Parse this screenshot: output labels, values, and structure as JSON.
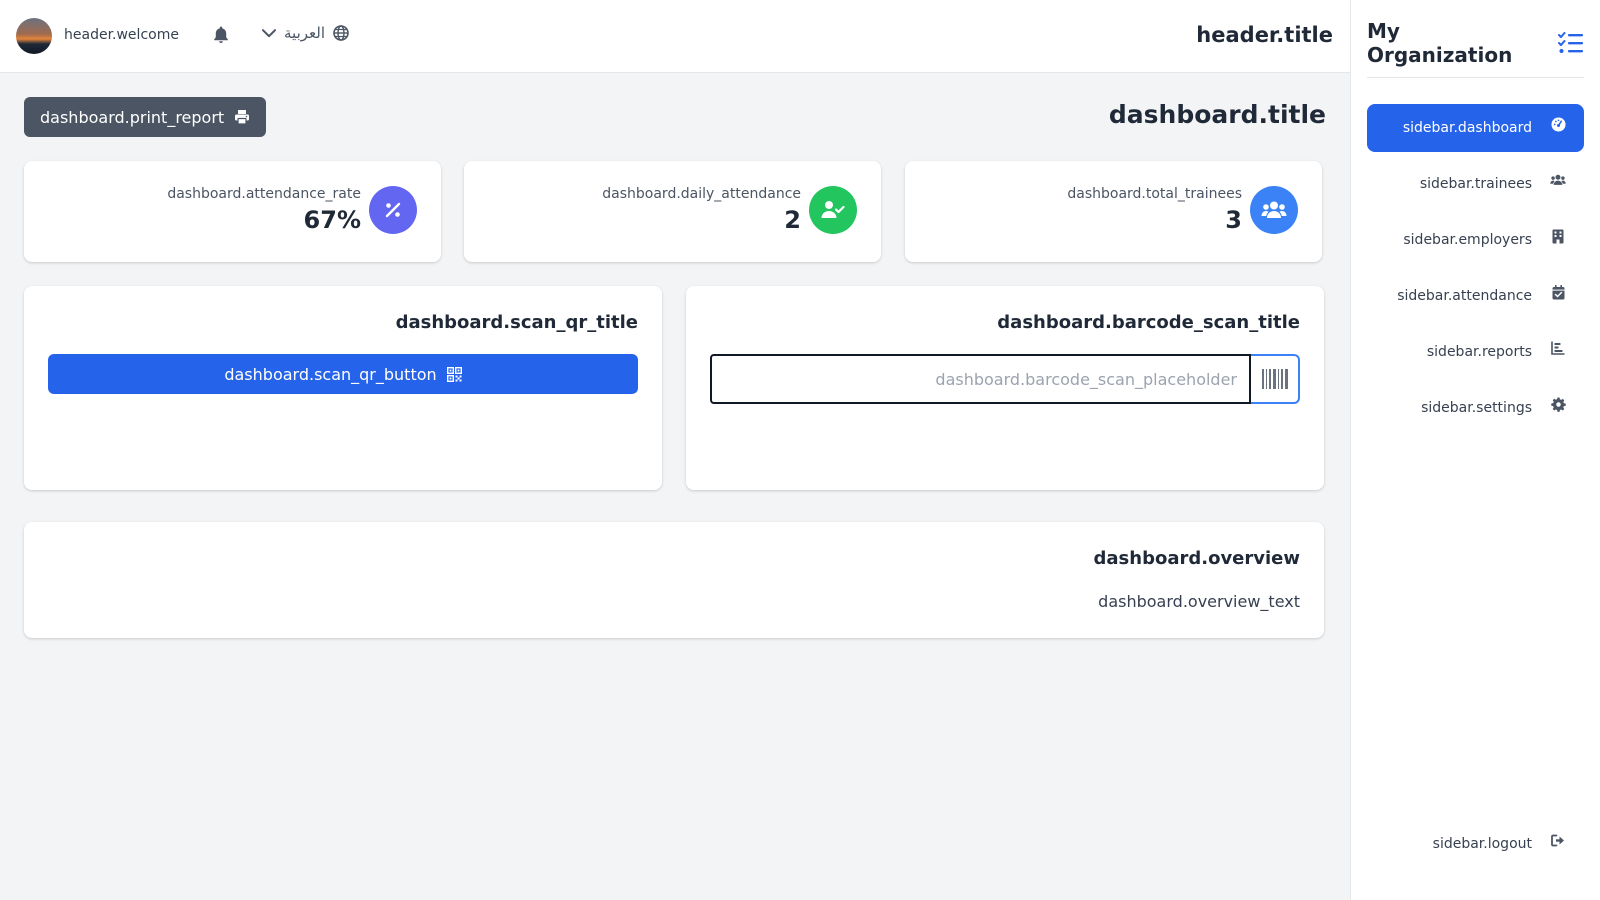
{
  "header": {
    "welcome": "header.welcome",
    "language": "العربية",
    "title": "header.title"
  },
  "sidebar": {
    "brand": "My Organization",
    "items": [
      {
        "label": "sidebar.dashboard",
        "icon": "gauge-icon",
        "active": true
      },
      {
        "label": "sidebar.trainees",
        "icon": "users-icon"
      },
      {
        "label": "sidebar.employers",
        "icon": "building-icon"
      },
      {
        "label": "sidebar.attendance",
        "icon": "calendar-check-icon"
      },
      {
        "label": "sidebar.reports",
        "icon": "chart-bar-icon"
      },
      {
        "label": "sidebar.settings",
        "icon": "gear-icon"
      }
    ],
    "logout": "sidebar.logout"
  },
  "dashboard": {
    "title": "dashboard.title",
    "print_report": "dashboard.print_report",
    "stats": [
      {
        "label": "dashboard.attendance_rate",
        "value": "67%",
        "icon": "percent-icon",
        "color": "#6366f1"
      },
      {
        "label": "dashboard.daily_attendance",
        "value": "2",
        "icon": "user-check-icon",
        "color": "#22c55e"
      },
      {
        "label": "dashboard.total_trainees",
        "value": "3",
        "icon": "users-icon",
        "color": "#3b82f6"
      }
    ],
    "scan_qr_title": "dashboard.scan_qr_title",
    "scan_qr_button": "dashboard.scan_qr_button",
    "barcode_scan_title": "dashboard.barcode_scan_title",
    "barcode_scan_placeholder": "dashboard.barcode_scan_placeholder",
    "overview": "dashboard.overview",
    "overview_text": "dashboard.overview_text"
  },
  "colors": {
    "primary": "#2563eb",
    "print_button": "#4b5563",
    "background": "#f3f4f6"
  }
}
